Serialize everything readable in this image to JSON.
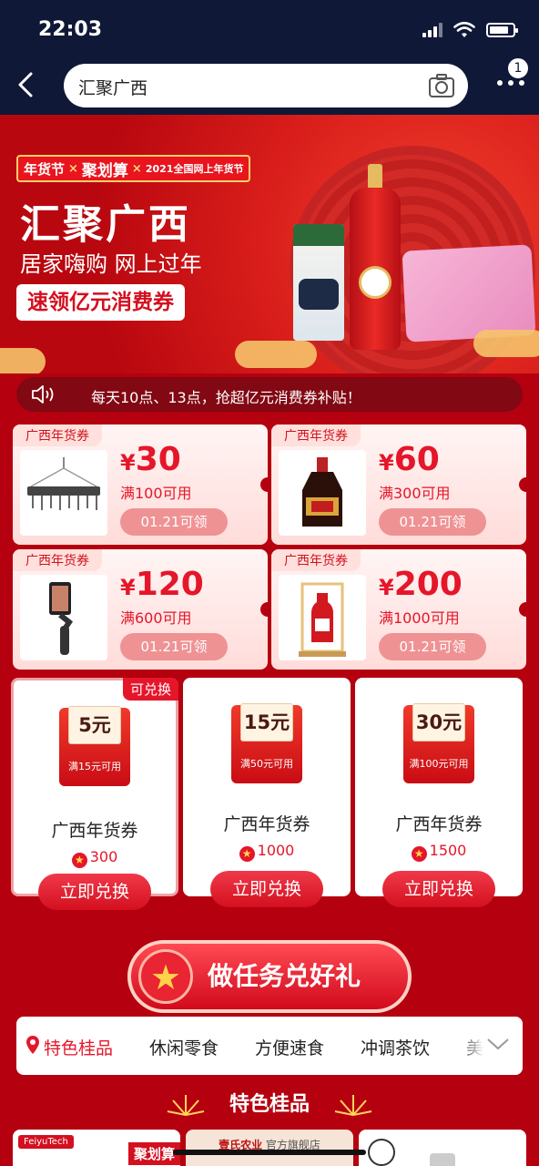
{
  "status": {
    "time": "22:03"
  },
  "header": {
    "search_text": "汇聚广西",
    "notification_count": "1"
  },
  "banner": {
    "tags": [
      "年货节",
      "×",
      "聚划算",
      "×",
      "2021全国网上年货节"
    ],
    "title": "汇聚广西",
    "subtitle": "居家嗨购  网上过年",
    "button": "速领亿元消费券"
  },
  "notice": "每天10点、13点，抢超亿元消费券补贴！",
  "coupons": [
    {
      "tag": "广西年货券",
      "currency": "¥",
      "amount": "30",
      "condition": "满100可用",
      "button": "01.21可领",
      "image": "hanger-rack"
    },
    {
      "tag": "广西年货券",
      "currency": "¥",
      "amount": "60",
      "condition": "满300可用",
      "button": "01.21可领",
      "image": "soy-sauce-bottle"
    },
    {
      "tag": "广西年货券",
      "currency": "¥",
      "amount": "120",
      "condition": "满600可用",
      "button": "01.21可领",
      "image": "phone-gimbal"
    },
    {
      "tag": "广西年货券",
      "currency": "¥",
      "amount": "200",
      "condition": "满1000可用",
      "button": "01.21可领",
      "image": "liquor-gift-box"
    }
  ],
  "redeem": [
    {
      "flag": "可兑换",
      "value": "5元",
      "condition": "满15元可用",
      "name": "广西年货券",
      "points": "300",
      "button": "立即兑换"
    },
    {
      "flag": "",
      "value": "15元",
      "condition": "满50元可用",
      "name": "广西年货券",
      "points": "1000",
      "button": "立即兑换"
    },
    {
      "flag": "",
      "value": "30元",
      "condition": "满100元可用",
      "name": "广西年货券",
      "points": "1500",
      "button": "立即兑换"
    }
  ],
  "task_button": "做任务兑好礼",
  "categories": [
    "特色桂品",
    "休闲零食",
    "方便速食",
    "冲调茶饮",
    "美"
  ],
  "section_title": "特色桂品",
  "products": [
    {
      "badge": "FeiyuTech",
      "label": "聚划算"
    },
    {
      "label": "壹氏农业",
      "sublabel": "官方旗舰店"
    },
    {
      "label": ""
    }
  ],
  "colors": {
    "accent": "#e5162a",
    "header_bg": "#0f1837",
    "page_bg": "#b5000f"
  }
}
